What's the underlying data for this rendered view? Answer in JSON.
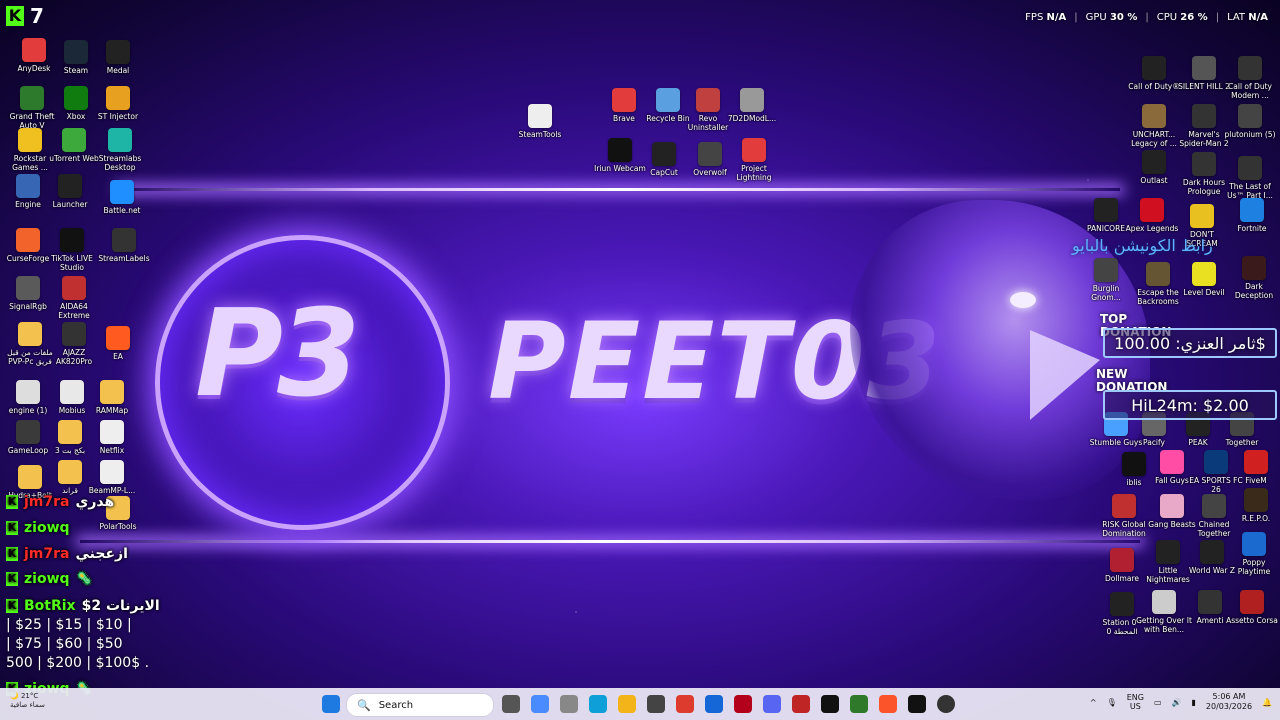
{
  "kick": {
    "icon_label": "K",
    "viewers": "7"
  },
  "stats": {
    "fps_label": "FPS",
    "fps": "N/A",
    "gpu_label": "GPU",
    "gpu": "30 %",
    "cpu_label": "CPU",
    "cpu": "26 %",
    "lat_label": "LAT",
    "lat": "N/A"
  },
  "brand": {
    "logo": "P3",
    "name": "PEET03"
  },
  "desktop_icons": [
    {
      "label": "AnyDesk"
    },
    {
      "label": "Steam"
    },
    {
      "label": "Medal"
    },
    {
      "label": "Grand Theft Auto V"
    },
    {
      "label": "Xbox"
    },
    {
      "label": "ST Injector"
    },
    {
      "label": "Rockstar Games ..."
    },
    {
      "label": "uTorrent Web"
    },
    {
      "label": "Streamlabs Desktop"
    },
    {
      "label": "Engine"
    },
    {
      "label": "Launcher"
    },
    {
      "label": "Battle.net"
    },
    {
      "label": "CurseForge"
    },
    {
      "label": "TikTok LIVE Studio"
    },
    {
      "label": "StreamLabels"
    },
    {
      "label": "SignalRgb"
    },
    {
      "label": "AIDA64 Extreme"
    },
    {
      "label": "ملفات من قبل PVP-Pc فريق"
    },
    {
      "label": "AJAZZ AK820Pro"
    },
    {
      "label": "EA"
    },
    {
      "label": "engine (1)"
    },
    {
      "label": "Mobius"
    },
    {
      "label": "RAMMap"
    },
    {
      "label": "GameLoop"
    },
    {
      "label": "بكج بت 3"
    },
    {
      "label": "Netflix"
    },
    {
      "label": "Hydra+Bolt"
    },
    {
      "label": "قراند"
    },
    {
      "label": "BeamMP-L..."
    },
    {
      "label": "PolarTools"
    },
    {
      "label": "SteamTools"
    },
    {
      "label": "Brave"
    },
    {
      "label": "Recycle Bin"
    },
    {
      "label": "Revo Uninstaller"
    },
    {
      "label": "7D2DModL..."
    },
    {
      "label": "Iriun Webcam"
    },
    {
      "label": "CapCut"
    },
    {
      "label": "Overwolf"
    },
    {
      "label": "Project Lightning"
    },
    {
      "label": "Call of Duty®"
    },
    {
      "label": "SILENT HILL 2"
    },
    {
      "label": "Call of Duty Modern ..."
    },
    {
      "label": "UNCHART... Legacy of ..."
    },
    {
      "label": "Marvel's Spider-Man 2"
    },
    {
      "label": "plutonium (5)"
    },
    {
      "label": "Outlast"
    },
    {
      "label": "Dark Hours Prologue"
    },
    {
      "label": "The Last of Us™ Part I..."
    },
    {
      "label": "PANICORE"
    },
    {
      "label": "Apex Legends"
    },
    {
      "label": "DON'T SCREAM"
    },
    {
      "label": "Fortnite"
    },
    {
      "label": "Burglin Gnom..."
    },
    {
      "label": "Escape the Backrooms"
    },
    {
      "label": "Level Devil"
    },
    {
      "label": "Dark Deception"
    },
    {
      "label": "Stumble Guys"
    },
    {
      "label": "Pacify"
    },
    {
      "label": "PEAK"
    },
    {
      "label": "Together"
    },
    {
      "label": "iblis"
    },
    {
      "label": "Fall Guys"
    },
    {
      "label": "EA SPORTS FC 26"
    },
    {
      "label": "FiveM"
    },
    {
      "label": "RISK Global Domination"
    },
    {
      "label": "Gang Beasts"
    },
    {
      "label": "Chained Together"
    },
    {
      "label": "R.E.P.O."
    },
    {
      "label": "Dollmare"
    },
    {
      "label": "Little Nightmares"
    },
    {
      "label": "World War Z"
    },
    {
      "label": "Poppy Playtime"
    },
    {
      "label": "Station 0 - المحطة 0"
    },
    {
      "label": "Getting Over It with Ben..."
    },
    {
      "label": "Amenti"
    },
    {
      "label": "Assetto Corsa"
    }
  ],
  "overlay": {
    "arabic_banner": "رابط الكونيشن بالبايو",
    "top_donation_label": "TOP DONATION",
    "top_donation_value": "ثامر العنزي: 100.00$",
    "new_donation_label": "NEW DONATION",
    "new_donation_value": "HiL24m: $2.00"
  },
  "chat": [
    {
      "user": "jm7ra",
      "msg": "هدري",
      "user_color": "#ff2a2a"
    },
    {
      "user": "ziowq",
      "msg": "",
      "user_color": "#53fc18"
    },
    {
      "user": "jm7ra",
      "msg": "ازعجني",
      "user_color": "#ff2a2a"
    },
    {
      "user": "ziowq",
      "msg": "🦠",
      "user_color": "#53fc18"
    },
    {
      "user": "BotRix",
      "msg": "$2 الايرنات",
      "user_color": "#53fc18"
    },
    {
      "user": "ziowq",
      "msg": "🦠",
      "user_color": "#53fc18"
    }
  ],
  "prices": "| $25 | $15 | $10 |\n| $75 | $60 | $50\n500 | $200 | $100$ .",
  "taskbar": {
    "weather_temp": "21°C",
    "weather_text": "سماء صافية",
    "search_placeholder": "Search",
    "lang": "ENG",
    "region": "US",
    "time": "5:06 AM",
    "date": "20/03/2026"
  },
  "colors": {
    "kick_green": "#53fc18",
    "accent_purple": "#8a4dff",
    "donation_border": "#9ec9ff"
  }
}
